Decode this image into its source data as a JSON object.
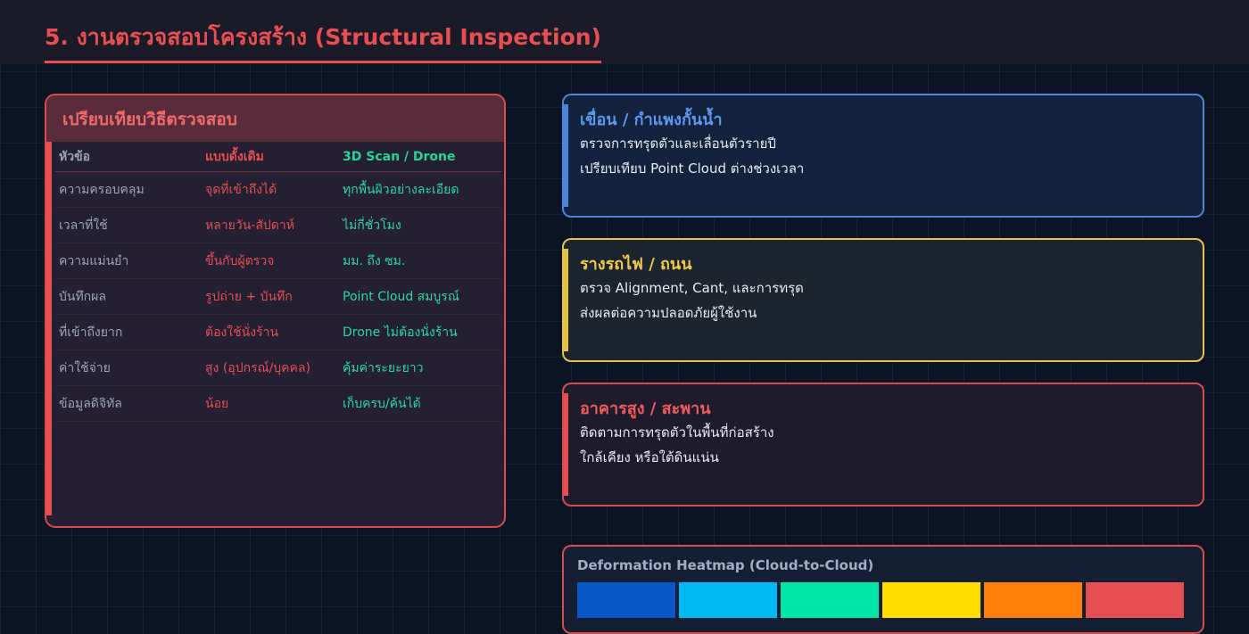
{
  "page": {
    "title": "5. งานตรวจสอบโครงสร้าง (Structural Inspection)"
  },
  "comparison": {
    "title": "เปรียบเทียบวิธีตรวจสอบ",
    "headers": [
      "หัวข้อ",
      "แบบดั้งเดิม",
      "3D Scan / Drone"
    ],
    "rows": [
      [
        "ความครอบคลุม",
        "จุดที่เข้าถึงได้",
        "ทุกพื้นผิวอย่างละเอียด"
      ],
      [
        "เวลาที่ใช้",
        "หลายวัน-สัปดาห์",
        "ไม่กี่ชั่วโมง"
      ],
      [
        "ความแม่นยำ",
        "ขึ้นกับผู้ตรวจ",
        "มม. ถึง ซม."
      ],
      [
        "บันทึกผล",
        "รูปถ่าย + บันทึก",
        "Point Cloud สมบูรณ์"
      ],
      [
        "ที่เข้าถึงยาก",
        "ต้องใช้นั่งร้าน",
        "Drone ไม่ต้องนั่งร้าน"
      ],
      [
        "ค่าใช้จ่าย",
        "สูง (อุปกรณ์/บุคคล)",
        "คุ้มค่าระยะยาว"
      ],
      [
        "ข้อมูลดิจิทัล",
        "น้อย",
        "เก็บครบ/ค้นได้"
      ]
    ]
  },
  "cards": {
    "dam": {
      "title": "เขื่อน / กำแพงกั้นน้ำ",
      "line1": "ตรวจการทรุดตัวและเลื่อนตัวรายปี",
      "line2": "เปรียบเทียบ Point Cloud ต่างช่วงเวลา"
    },
    "rail": {
      "title": "รางรถไฟ / ถนน",
      "line1": "ตรวจ Alignment, Cant, และการทรุด",
      "line2": "ส่งผลต่อความปลอดภัยผู้ใช้งาน"
    },
    "building": {
      "title": "อาคารสูง / สะพาน",
      "line1": "ติดตามการทรุดตัวในพื้นที่ก่อสร้าง",
      "line2": "ใกล้เคียง หรือใต้ดินแน่น"
    }
  },
  "heatmap": {
    "title": "Deformation Heatmap (Cloud-to-Cloud)",
    "colors": [
      "#0a56c8",
      "#00b8f2",
      "#00e6a6",
      "#ffdd00",
      "#ff7f0a",
      "#e84f52"
    ]
  }
}
